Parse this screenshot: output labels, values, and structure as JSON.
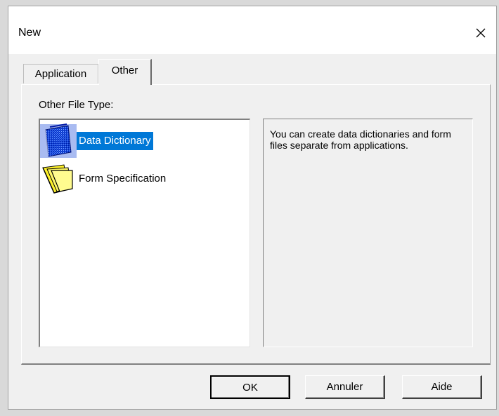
{
  "window": {
    "title": "New"
  },
  "tabs": [
    {
      "label": "Application",
      "active": false
    },
    {
      "label": "Other",
      "active": true
    }
  ],
  "panel": {
    "group_label": "Other File Type:",
    "items": [
      {
        "label": "Data Dictionary",
        "icon": "data-dictionary-icon",
        "selected": true
      },
      {
        "label": "Form Specification",
        "icon": "form-specification-icon",
        "selected": false
      }
    ],
    "description": "You can create data dictionaries and form files separate from applications."
  },
  "buttons": {
    "ok": "OK",
    "cancel": "Annuler",
    "help": "Aide"
  },
  "colors": {
    "selection": "#0078d7",
    "dialog_bg": "#f0f0f0"
  }
}
